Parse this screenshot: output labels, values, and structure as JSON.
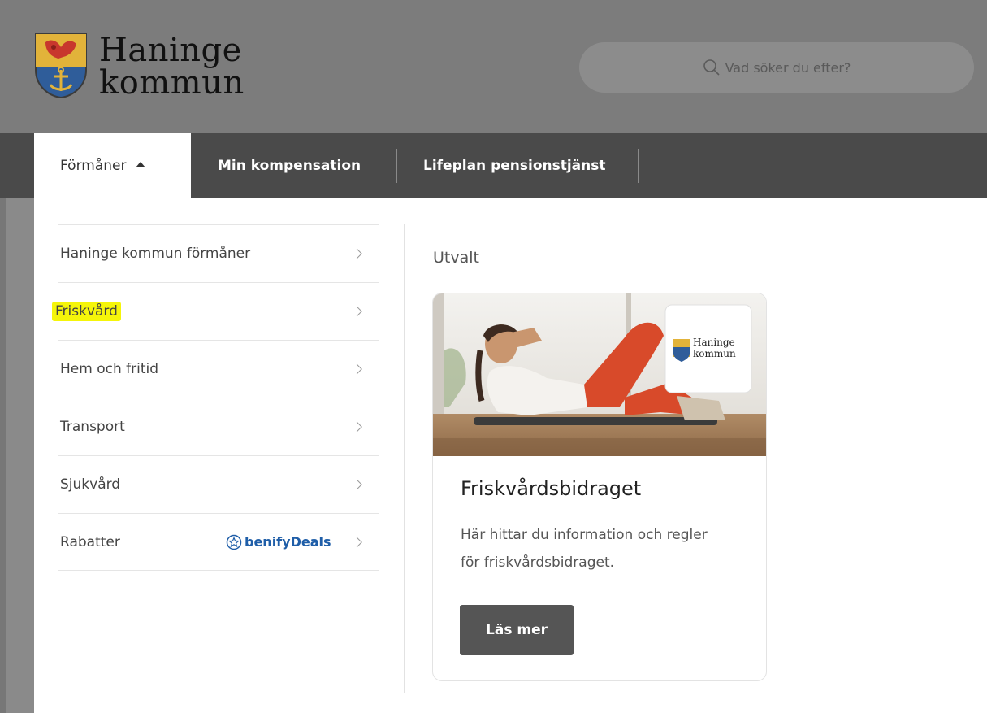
{
  "brand": {
    "logo_line1": "Haninge",
    "logo_line2": "kommun"
  },
  "search": {
    "placeholder": "Vad söker du efter?"
  },
  "nav": {
    "items": [
      {
        "label": "Förmåner",
        "active": true
      },
      {
        "label": "Min kompensation",
        "active": false
      },
      {
        "label": "Lifeplan pensionstjänst",
        "active": false
      }
    ]
  },
  "menu": {
    "items": [
      {
        "label": "Haninge kommun förmåner"
      },
      {
        "label": "Friskvård",
        "highlighted": true,
        "highlight_color": "#f5f50a"
      },
      {
        "label": "Hem och fritid"
      },
      {
        "label": "Transport"
      },
      {
        "label": "Sjukvård"
      },
      {
        "label": "Rabatter",
        "badge": "benifyDeals"
      }
    ]
  },
  "featured": {
    "title": "Utvalt",
    "card": {
      "image_logo_line1": "Haninge",
      "image_logo_line2": "kommun",
      "title": "Friskvårdsbidraget",
      "description": "Här hittar du information och regler för friskvårdsbidraget.",
      "button_label": "Läs mer"
    }
  },
  "colors": {
    "nav_bg": "#4a4a4a",
    "button_bg": "#555555",
    "benify_blue": "#1f5ea8",
    "highlight": "#f5f50a"
  }
}
